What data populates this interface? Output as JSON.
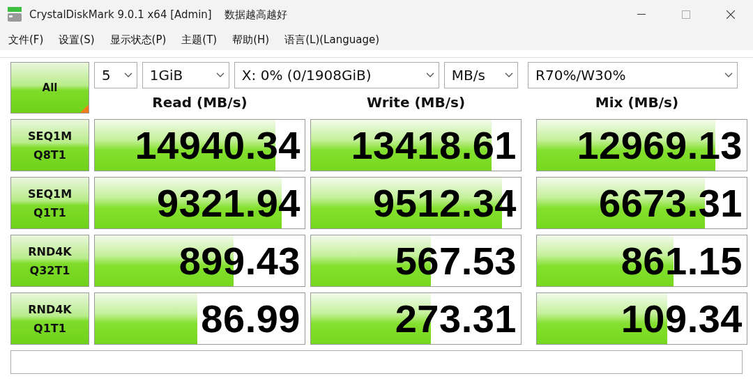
{
  "window": {
    "title": "CrystalDiskMark 9.0.1 x64 [Admin]",
    "subtitle": "数据越高越好"
  },
  "menu": [
    "文件(F)",
    "设置(S)",
    "显示状态(P)",
    "主题(T)",
    "帮助(H)",
    "语言(L)(Language)"
  ],
  "controls": {
    "all_button": "All",
    "test_count": "5",
    "test_size": "1GiB",
    "drive": "X: 0% (0/1908GiB)",
    "unit": "MB/s",
    "mix_ratio": "R70%/W30%"
  },
  "columns": [
    "Read (MB/s)",
    "Write (MB/s)",
    "Mix (MB/s)"
  ],
  "rows": [
    {
      "test": "SEQ1M",
      "queue": "Q8T1",
      "results": [
        {
          "value": "14940.34",
          "level": 0.86
        },
        {
          "value": "13418.61",
          "level": 0.86
        },
        {
          "value": "12969.13",
          "level": 0.85
        }
      ]
    },
    {
      "test": "SEQ1M",
      "queue": "Q1T1",
      "results": [
        {
          "value": "9321.94",
          "level": 0.89
        },
        {
          "value": "9512.34",
          "level": 0.91
        },
        {
          "value": "6673.31",
          "level": 0.8
        }
      ]
    },
    {
      "test": "RND4K",
      "queue": "Q32T1",
      "results": [
        {
          "value": "899.43",
          "level": 0.66
        },
        {
          "value": "567.53",
          "level": 0.57
        },
        {
          "value": "861.15",
          "level": 0.65
        }
      ]
    },
    {
      "test": "RND4K",
      "queue": "Q1T1",
      "results": [
        {
          "value": "86.99",
          "level": 0.49
        },
        {
          "value": "273.31",
          "level": 0.57
        },
        {
          "value": "109.34",
          "level": 0.62
        }
      ]
    }
  ]
}
